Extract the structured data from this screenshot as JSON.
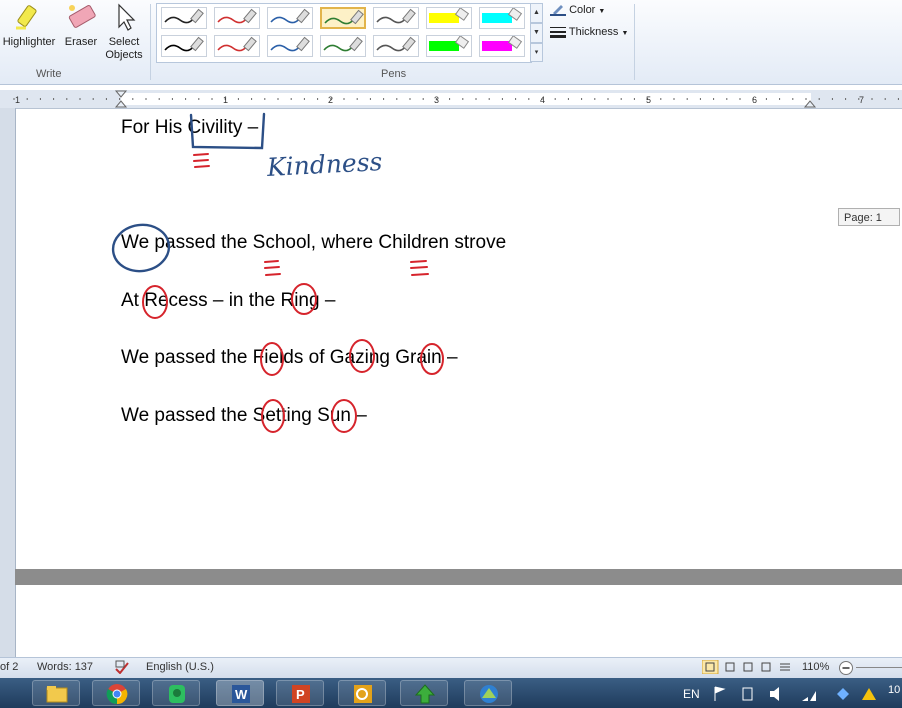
{
  "ribbon": {
    "write_group": {
      "label": "Write",
      "highlighter": "Highlighter",
      "eraser": "Eraser",
      "select_objects": "Select Objects"
    },
    "pens_group": {
      "label": "Pens",
      "pens": [
        {
          "color": "#222222",
          "kind": "pen"
        },
        {
          "color": "#d03030",
          "kind": "pen"
        },
        {
          "color": "#2a5fa8",
          "kind": "pen"
        },
        {
          "color": "#2e7d32",
          "kind": "pen",
          "selected": true
        },
        {
          "color": "#555555",
          "kind": "pen"
        },
        {
          "color": "#ffff00",
          "kind": "highlighter"
        },
        {
          "color": "#00ffff",
          "kind": "highlighter"
        },
        {
          "color": "#000000",
          "kind": "pen"
        },
        {
          "color": "#d03030",
          "kind": "pen"
        },
        {
          "color": "#2a5fa8",
          "kind": "pen"
        },
        {
          "color": "#2e7d32",
          "kind": "pen"
        },
        {
          "color": "#555555",
          "kind": "pen"
        },
        {
          "color": "#00ff00",
          "kind": "highlighter"
        },
        {
          "color": "#ff00ff",
          "kind": "highlighter"
        }
      ],
      "color_label": "Color",
      "thickness_label": "Thickness"
    }
  },
  "ruler": {
    "numbers": [
      "1",
      "1",
      "2",
      "3",
      "4",
      "5",
      "6",
      "7"
    ]
  },
  "document": {
    "lines": [
      "For His Civility –",
      "We passed the School, where Children strove",
      "At Recess – in the Ring –",
      "We passed the Fields of Gazing Grain –",
      "We passed the Setting Sun –"
    ],
    "handwritten_note": "Kindness",
    "page_tooltip": "Page: 1",
    "ink_colors": {
      "blue": "#2c4f86",
      "red": "#d6242c"
    }
  },
  "statusbar": {
    "page": "of 2",
    "words": "Words: 137",
    "language": "English (U.S.)",
    "zoom": "110%"
  },
  "taskbar": {
    "apps": [
      "explorer",
      "chrome",
      "evernote",
      "word",
      "powerpoint",
      "outlook",
      "app-green",
      "app-blue"
    ],
    "lang": "EN",
    "clock_partial": "10"
  }
}
